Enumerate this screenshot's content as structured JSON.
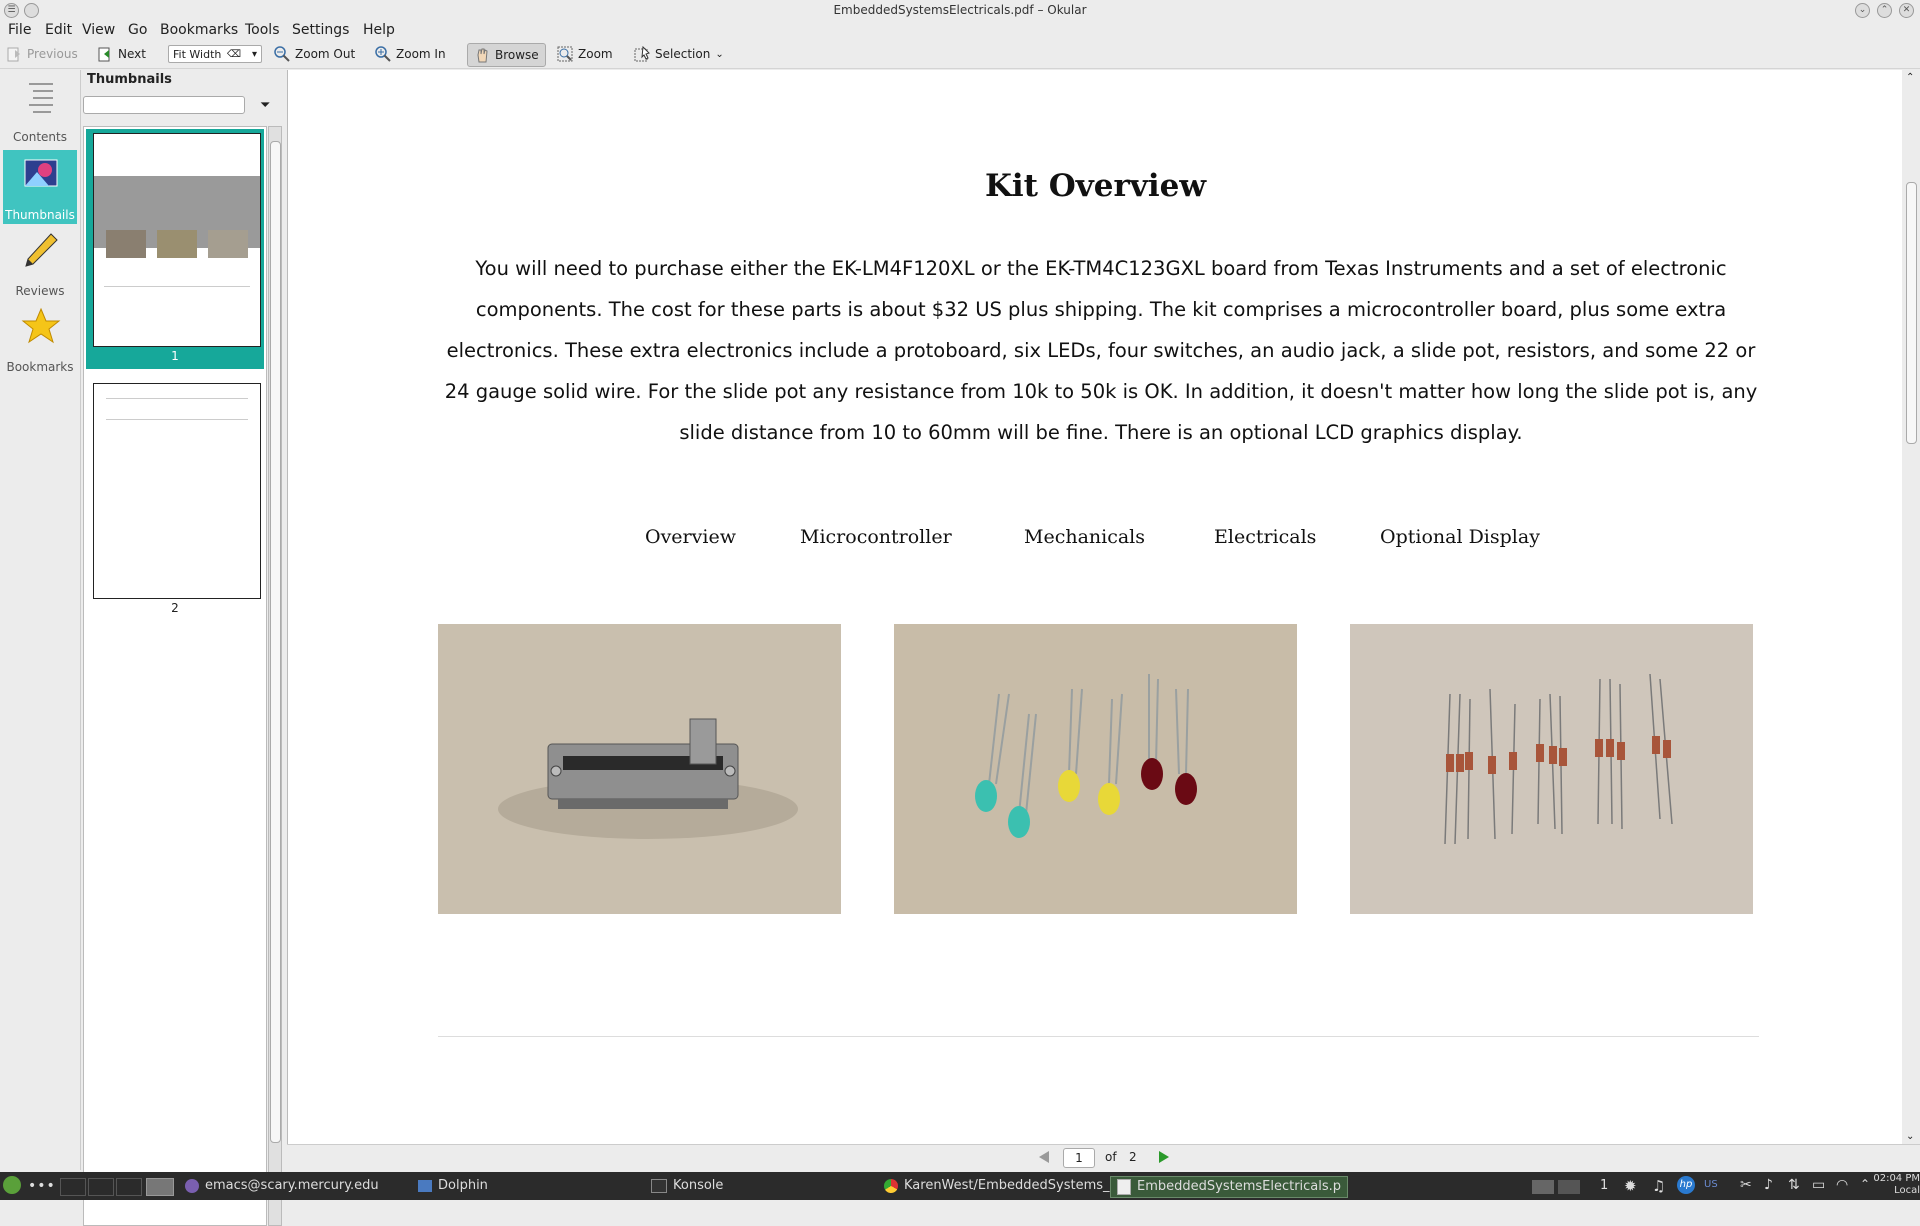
{
  "window": {
    "title": "EmbeddedSystemsElectricals.pdf – Okular"
  },
  "menu": [
    "File",
    "Edit",
    "View",
    "Go",
    "Bookmarks",
    "Tools",
    "Settings",
    "Help"
  ],
  "toolbar": {
    "previous": "Previous",
    "next": "Next",
    "zoom_mode": "Fit Width",
    "zoom_out": "Zoom Out",
    "zoom_in": "Zoom In",
    "browse": "Browse",
    "zoom": "Zoom",
    "selection": "Selection"
  },
  "sidebar": {
    "items": [
      {
        "label": "Contents",
        "icon": "contents-icon"
      },
      {
        "label": "Thumbnails",
        "icon": "thumbnails-icon",
        "active": true
      },
      {
        "label": "Reviews",
        "icon": "pencil-icon"
      },
      {
        "label": "Bookmarks",
        "icon": "star-icon"
      }
    ]
  },
  "thumbnails": {
    "header": "Thumbnails",
    "pages": [
      {
        "number": "1",
        "selected": true
      },
      {
        "number": "2",
        "selected": false
      }
    ]
  },
  "document": {
    "title": "Kit Overview",
    "paragraph": "You will need to purchase either the EK-LM4F120XL or the EK-TM4C123GXL board from Texas Instruments and a set of electronic components. The cost for these parts is about $32 US plus shipping. The kit comprises a microcontroller board, plus some extra electronics. These extra electronics include a protoboard, six LEDs, four switches, an audio jack, a slide pot, resistors, and some 22 or 24 gauge solid wire. For the slide pot any resistance from 10k to 50k is OK. In addition, it doesn't matter how long the slide pot is, any slide distance from 10 to 60mm will be fine. There is an optional LCD graphics display.",
    "nav": [
      "Overview",
      "Microcontroller",
      "Mechanicals",
      "Electricals",
      "Optional Display"
    ]
  },
  "pagebar": {
    "current": "1",
    "of": "of",
    "total": "2"
  },
  "taskbar": {
    "tasks": [
      "emacs@scary.mercury.edu",
      "Dolphin",
      "Konsole",
      "KarenWest/EmbeddedSystems_",
      "EmbeddedSystemsElectricals.p"
    ],
    "workspace": "1",
    "time": "02:04 PM",
    "tz": "Local"
  },
  "colors": {
    "accent": "#40c4c0",
    "selection": "#16a89a",
    "taskbar": "#2b2b2b"
  }
}
